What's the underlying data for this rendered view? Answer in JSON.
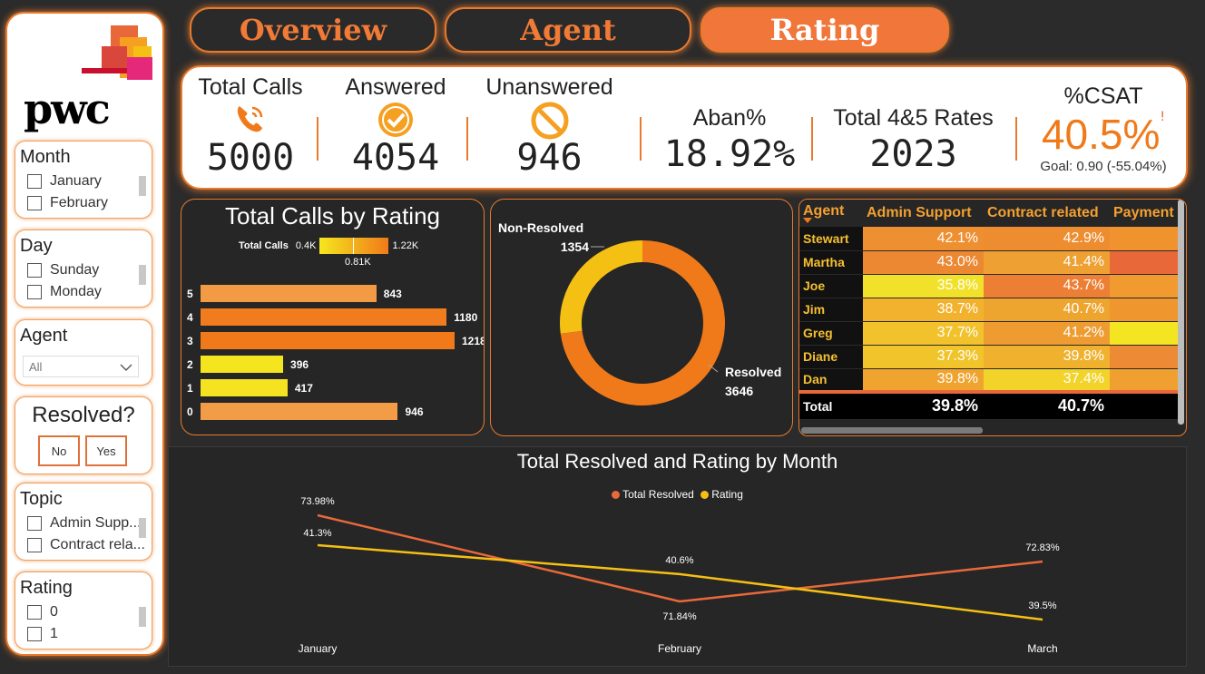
{
  "colors": {
    "accent": "#e87a2e",
    "tab_active": "#f0763a",
    "dark": "#262626",
    "resolved": "#f07a1a",
    "nonresolved": "#f5c014",
    "line_resolved": "#e8693a",
    "line_rating": "#f5c014"
  },
  "brand": {
    "name": "pwc"
  },
  "nav": {
    "tabs": [
      {
        "label": "Overview"
      },
      {
        "label": "Agent"
      },
      {
        "label": "Rating"
      }
    ],
    "active": "Rating"
  },
  "sidebar": {
    "month": {
      "title": "Month",
      "options": [
        "January",
        "February"
      ]
    },
    "day": {
      "title": "Day",
      "options": [
        "Sunday",
        "Monday"
      ]
    },
    "agent": {
      "title": "Agent",
      "selected": "All"
    },
    "resolved": {
      "title": "Resolved?",
      "options": [
        "No",
        "Yes"
      ]
    },
    "topic": {
      "title": "Topic",
      "options": [
        "Admin Supp...",
        "Contract rela..."
      ]
    },
    "rating": {
      "title": "Rating",
      "options": [
        "0",
        "1"
      ]
    }
  },
  "kpis": {
    "total_calls": {
      "label": "Total Calls",
      "value": "5000",
      "icon": "phone-icon"
    },
    "answered": {
      "label": "Answered",
      "value": "4054",
      "icon": "check-circle-icon"
    },
    "unanswered": {
      "label": "Unanswered",
      "value": "946",
      "icon": "prohibited-icon"
    },
    "aban": {
      "label": "Aban%",
      "value": "18.92%"
    },
    "total45": {
      "label": "Total 4&5 Rates",
      "value": "2023"
    },
    "csat": {
      "label": "%CSAT",
      "value": "40.5%",
      "marker": "!",
      "goal": "Goal: 0.90 (-55.04%)"
    }
  },
  "calls_by_rating": {
    "title": "Total Calls by Rating",
    "legend": {
      "label": "Total Calls",
      "min": "0.4K",
      "max": "1.22K",
      "mid": "0.81K"
    },
    "chart_data": {
      "type": "bar",
      "categories": [
        "5",
        "4",
        "3",
        "2",
        "1",
        "0"
      ],
      "values": [
        843,
        1180,
        1218,
        396,
        417,
        946
      ],
      "colors": [
        "#f39a45",
        "#f07c1e",
        "#f07a1a",
        "#f5e51f",
        "#f5e221",
        "#f39c48"
      ]
    }
  },
  "donut": {
    "chart_data": {
      "type": "pie",
      "categories": [
        "Non-Resolved",
        "Resolved"
      ],
      "values": [
        1354,
        3646
      ]
    },
    "labels": {
      "nonresolved_name": "Non-Resolved",
      "nonresolved_value": "1354",
      "resolved_name": "Resolved",
      "resolved_value": "3646"
    }
  },
  "matrix": {
    "headers": [
      "Agent",
      "Admin Support",
      "Contract related",
      "Payment"
    ],
    "rows": [
      {
        "agent": "Stewart",
        "admin": "42.1%",
        "contract": "42.9%",
        "c1": "#ee8f32",
        "c2": "#ee8c30",
        "c3": "#f0922e"
      },
      {
        "agent": "Martha",
        "admin": "43.0%",
        "contract": "41.4%",
        "c1": "#ec8732",
        "c2": "#eea033",
        "c3": "#e8683a"
      },
      {
        "agent": "Joe",
        "admin": "35.8%",
        "contract": "43.7%",
        "c1": "#f2e12a",
        "c2": "#ec7f34",
        "c3": "#f09a30"
      },
      {
        "agent": "Jim",
        "admin": "38.7%",
        "contract": "40.7%",
        "c1": "#f2b22e",
        "c2": "#eea530",
        "c3": "#f0962e"
      },
      {
        "agent": "Greg",
        "admin": "37.7%",
        "contract": "41.2%",
        "c1": "#f2c22c",
        "c2": "#ee9c32",
        "c3": "#f3e521"
      },
      {
        "agent": "Diane",
        "admin": "37.3%",
        "contract": "39.8%",
        "c1": "#f2c42c",
        "c2": "#f0b22e",
        "c3": "#ec8a36"
      },
      {
        "agent": "Dan",
        "admin": "39.8%",
        "contract": "37.4%",
        "c1": "#f0a430",
        "c2": "#f2d32a",
        "c3": "#f0a030"
      }
    ],
    "total": {
      "agent": "Total",
      "admin": "39.8%",
      "contract": "40.7%"
    }
  },
  "monthly": {
    "title": "Total Resolved and Rating by Month",
    "chart_data": {
      "type": "line",
      "categories": [
        "January",
        "February",
        "March"
      ],
      "series": [
        {
          "name": "Total Resolved",
          "values": [
            73.98,
            71.84,
            72.83
          ],
          "labels": [
            "73.98%",
            "71.84%",
            "72.83%"
          ]
        },
        {
          "name": "Rating",
          "values": [
            41.3,
            40.6,
            39.5
          ],
          "labels": [
            "41.3%",
            "40.6%",
            "39.5%"
          ]
        }
      ]
    }
  }
}
